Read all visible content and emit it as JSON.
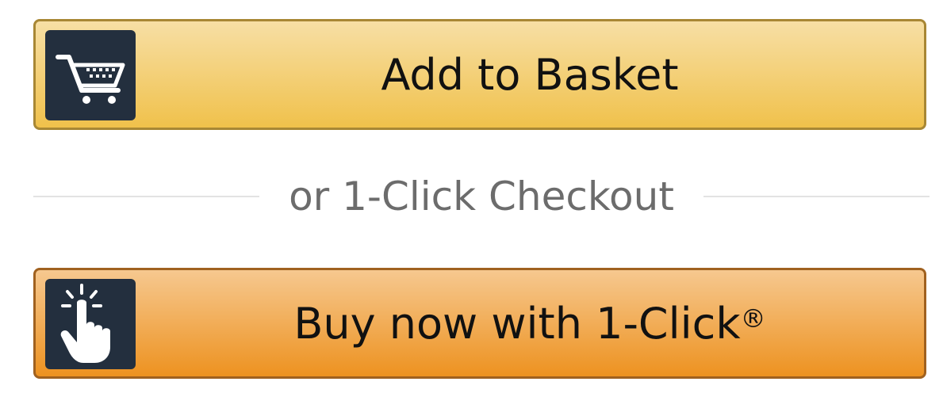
{
  "add_to_basket": {
    "label": "Add to Basket",
    "icon": "shopping-cart-icon",
    "color": "#f0c14b",
    "border_color": "#a88734"
  },
  "divider": {
    "text": "or 1-Click Checkout"
  },
  "buy_now": {
    "label": "Buy now with 1-Click",
    "trademark": "®",
    "icon": "pointing-hand-click-icon",
    "color": "#ed9220",
    "border_color": "#a0611f"
  },
  "colors": {
    "icon_background": "#232f3e",
    "divider_text": "#6c6c6c",
    "divider_line": "#e3e3e3"
  }
}
